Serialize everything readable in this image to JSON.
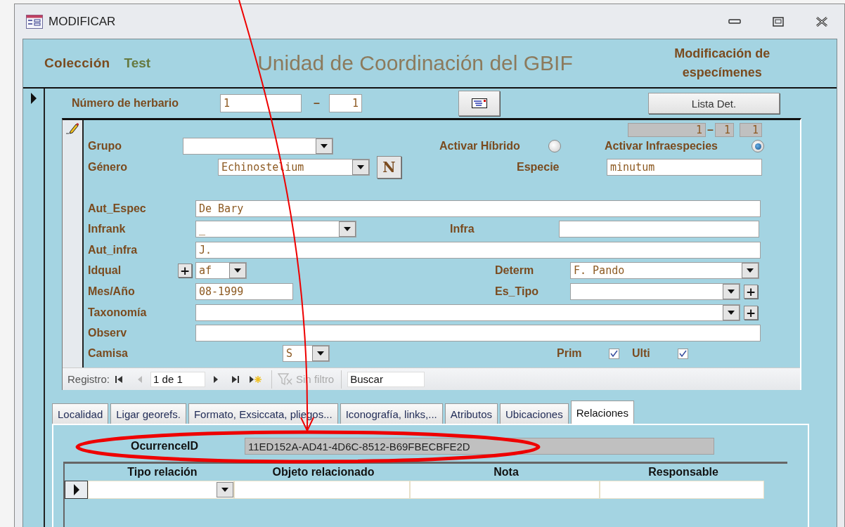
{
  "window": {
    "title": "MODIFICAR"
  },
  "header": {
    "collection_label": "Colección",
    "collection_value": "Test",
    "title": "Unidad de Coordinación del GBIF",
    "subtitle": "Modificación de especímenes"
  },
  "herbarium": {
    "label": "Número de herbario",
    "number": "1",
    "separator": "–",
    "suffix": "1",
    "list_button": "Lista Det."
  },
  "record_ids": {
    "first": "1",
    "separator": "–",
    "second": "1",
    "third": "1"
  },
  "toggles": [
    {
      "label": "Activar Híbrido",
      "selected": false
    },
    {
      "label": "Activar Infraespecies",
      "selected": true
    }
  ],
  "form": {
    "grupo": {
      "label": "Grupo"
    },
    "genero": {
      "label": "Género",
      "value": "Echinostelium",
      "new_button": "N"
    },
    "especie": {
      "label": "Especie",
      "value": "minutum"
    },
    "aut_espec": {
      "label": "Aut_Espec",
      "value": "De Bary"
    },
    "infrank": {
      "label": "Infrank",
      "value": "_"
    },
    "infra": {
      "label": "Infra"
    },
    "aut_infra": {
      "label": "Aut_infra",
      "value": "J."
    },
    "idqual": {
      "label": "Idqual",
      "value": "af",
      "add_button": "+"
    },
    "determ": {
      "label": "Determ",
      "value": "F. Pando"
    },
    "mes_ano": {
      "label": "Mes/Año",
      "value": "08-1999"
    },
    "es_tipo": {
      "label": "Es_Tipo",
      "add_button": "+"
    },
    "taxonomia": {
      "label": "Taxonomía",
      "add_button": "+"
    },
    "observ": {
      "label": "Observ"
    },
    "camisa": {
      "label": "Camisa",
      "value": "S"
    },
    "checks": [
      {
        "label": "Prim",
        "checked": true
      },
      {
        "label": "Ulti",
        "checked": true
      }
    ]
  },
  "navigator": {
    "label": "Registro:",
    "position": "1 de 1",
    "filter": "Sin filtro",
    "filter_disabled": true,
    "search": "Buscar",
    "buttons": [
      {
        "kind": "first",
        "disabled": false
      },
      {
        "kind": "prev",
        "disabled": true
      },
      {
        "kind": "next",
        "disabled": false
      },
      {
        "kind": "last",
        "disabled": false
      },
      {
        "kind": "new",
        "disabled": false
      }
    ]
  },
  "tabs": [
    {
      "label": "Localidad",
      "selected": false
    },
    {
      "label": "Ligar georefs.",
      "selected": false
    },
    {
      "label": "Formato, Exsiccata, pliegos...",
      "selected": false
    },
    {
      "label": "Iconografía, links,...",
      "selected": false
    },
    {
      "label": "Atributos",
      "selected": false
    },
    {
      "label": "Ubicaciones",
      "selected": false
    },
    {
      "label": "Relaciones",
      "selected": true
    }
  ],
  "occurrence": {
    "label": "OcurrenceID",
    "value": "11ED152A-AD41-4D6C-8512-B69FBECBFE2D"
  },
  "relations_table": {
    "columns": [
      "Tipo relación",
      "Objeto relacionado",
      "Nota",
      "Responsable"
    ]
  }
}
